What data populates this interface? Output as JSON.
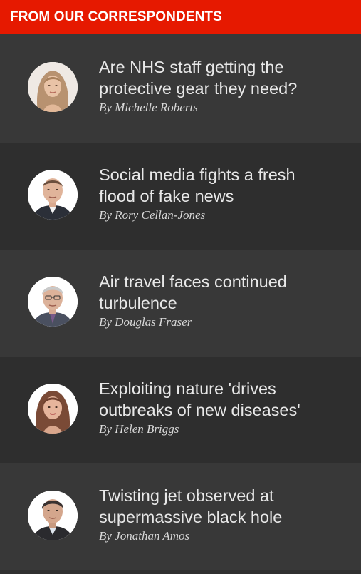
{
  "header": {
    "title": "FROM OUR CORRESPONDENTS"
  },
  "items": [
    {
      "headline": "Are NHS staff getting the protective gear they need?",
      "byline": "By Michelle Roberts",
      "avatar_icon": "correspondent-photo-michelle-roberts"
    },
    {
      "headline": "Social media fights a fresh flood of fake news",
      "byline": "By Rory Cellan-Jones",
      "avatar_icon": "correspondent-photo-rory-cellan-jones"
    },
    {
      "headline": "Air travel faces continued turbulence",
      "byline": "By Douglas Fraser",
      "avatar_icon": "correspondent-photo-douglas-fraser"
    },
    {
      "headline": "Exploiting nature 'drives outbreaks of new diseases'",
      "byline": "By Helen Briggs",
      "avatar_icon": "correspondent-photo-helen-briggs"
    },
    {
      "headline": "Twisting jet observed at supermassive black hole",
      "byline": "By Jonathan Amos",
      "avatar_icon": "correspondent-photo-jonathan-amos"
    }
  ],
  "colors": {
    "header_bg": "#e61900",
    "row_light": "#383838",
    "row_dark": "#2e2e2e",
    "text": "#e8e8e8"
  }
}
